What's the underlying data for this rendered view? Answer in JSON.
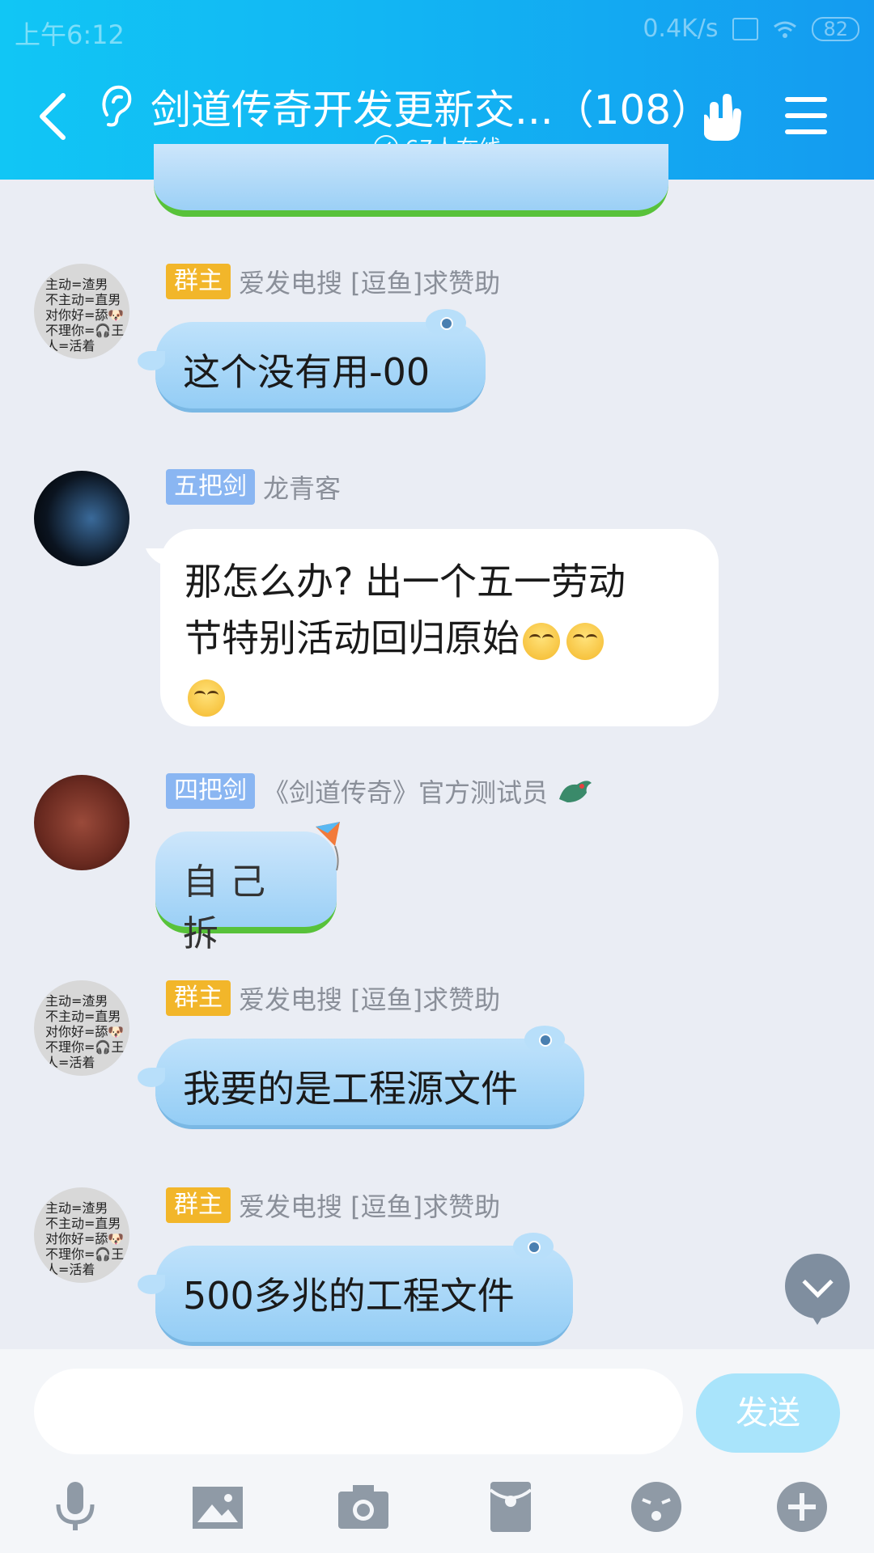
{
  "status_bar": {
    "time": "上午6:12",
    "speed": "0.4K/s",
    "battery": "82"
  },
  "header": {
    "title": "剑道传奇开发更新交...（108）",
    "online": "67人在线"
  },
  "messages": [
    {
      "badge": "群主",
      "nickname": "爱发电搜 [逗鱼]求赞助",
      "text": "这个没有用-00",
      "avatar_text": [
        "主动=渣男",
        "不主动=直男",
        "对你好=舔🐶",
        "不理你=🎧王",
        "人=活着"
      ]
    },
    {
      "badge": "五把剑",
      "nickname": "龙青客",
      "text_line1": "那怎么办? 出一个五一劳动",
      "text_line2": "节特别活动回归原始"
    },
    {
      "badge": "四把剑",
      "nickname": "《剑道传奇》官方测试员",
      "text": "自己拆"
    },
    {
      "badge": "群主",
      "nickname": "爱发电搜 [逗鱼]求赞助",
      "text": "我要的是工程源文件"
    },
    {
      "badge": "群主",
      "nickname": "爱发电搜 [逗鱼]求赞助",
      "text": "500多兆的工程文件"
    }
  ],
  "input": {
    "placeholder": "",
    "send_label": "发送"
  },
  "toolbar": [
    "mic-icon",
    "image-icon",
    "camera-icon",
    "red-packet-icon",
    "emoji-icon",
    "plus-icon"
  ]
}
